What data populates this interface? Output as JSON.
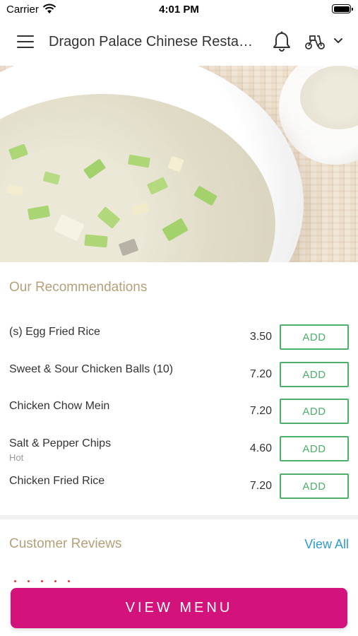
{
  "status_bar": {
    "carrier": "Carrier",
    "time": "4:01 PM"
  },
  "header": {
    "title": "Dragon Palace Chinese Resta…",
    "icons": [
      "menu-icon",
      "bell-icon",
      "scooter-icon",
      "chevron-down-icon"
    ]
  },
  "hero": {
    "description_icon": "hero-image"
  },
  "recommendations": {
    "title": "Our Recommendations",
    "items": [
      {
        "name": "(s) Egg Fried Rice",
        "subtitle": "",
        "price": "3.50",
        "button": "ADD"
      },
      {
        "name": "Sweet & Sour Chicken Balls (10)",
        "subtitle": "",
        "price": "7.20",
        "button": "ADD"
      },
      {
        "name": "Chicken Chow Mein",
        "subtitle": "",
        "price": "7.20",
        "button": "ADD"
      },
      {
        "name": "Salt & Pepper Chips",
        "subtitle": "Hot",
        "price": "4.60",
        "button": "ADD"
      },
      {
        "name": "Chicken Fried Rice",
        "subtitle": "",
        "price": "7.20",
        "button": "ADD"
      }
    ]
  },
  "reviews": {
    "title": "Customer Reviews",
    "view_all": "View All"
  },
  "footer": {
    "view_menu": "VIEW MENU"
  },
  "colors": {
    "accent": "#d4127c",
    "add_button": "#4caf6a",
    "section_title": "#b5a07a",
    "link": "#2f9bd3"
  }
}
